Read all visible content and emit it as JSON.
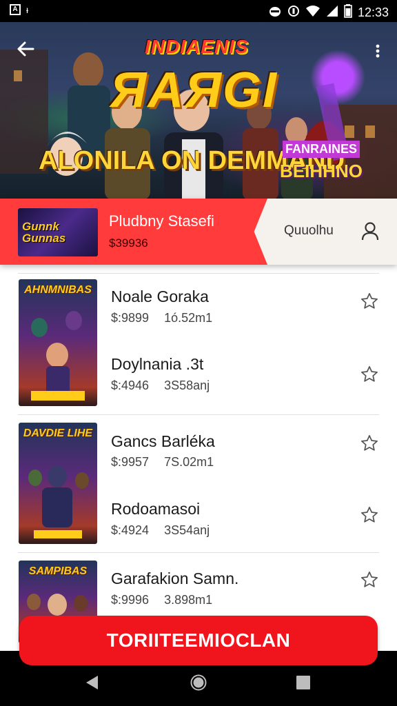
{
  "status_bar": {
    "left_icon_label": "A",
    "left_text": "ᵻ",
    "time": "12:33"
  },
  "hero": {
    "title_small": "INDIAENIS",
    "title_big": "ЯAЯGI",
    "subtitle": "ALONILA ON DEMMAND",
    "badge_top": "FANRAINES",
    "badge_bottom": "BEIHHNO"
  },
  "featured": {
    "thumb_text": "Gunnk Gunnas",
    "title": "Pludbny Stasefi",
    "price": "$39936",
    "store_label": "Quuolhu",
    "colors": {
      "accent": "#ff3b3b"
    }
  },
  "items": [
    {
      "title": "Noale Goraka",
      "price": "$:9899",
      "meta": "1ó.52m1"
    },
    {
      "title": "Doylnania .3t",
      "price": "$:4946",
      "meta": "3S58anj"
    },
    {
      "title": "Gancs Barléka",
      "price": "$:9957",
      "meta": "7S.02m1"
    },
    {
      "title": "Rodoamasoi",
      "price": "$:4924",
      "meta": "3S54anj"
    },
    {
      "title": "Garafakion Samn.",
      "price": "$:9996",
      "meta": "3.898m1"
    }
  ],
  "covers": [
    {
      "title": "AHNMNIBAS"
    },
    {
      "title": "DAVDIE LIHE"
    },
    {
      "title": "SAMPIBAS"
    }
  ],
  "cta_label": "TORIITEEMIOCLAN",
  "icons": {
    "back": "arrow-left",
    "more": "more-vertical",
    "user": "user-outline",
    "star": "star-outline",
    "nav_back": "triangle-left",
    "nav_home": "circle",
    "nav_recent": "square"
  },
  "colors": {
    "cta": "#f0141c",
    "hero_title": "#ffcc1a",
    "text_primary": "#1a1a1a"
  }
}
